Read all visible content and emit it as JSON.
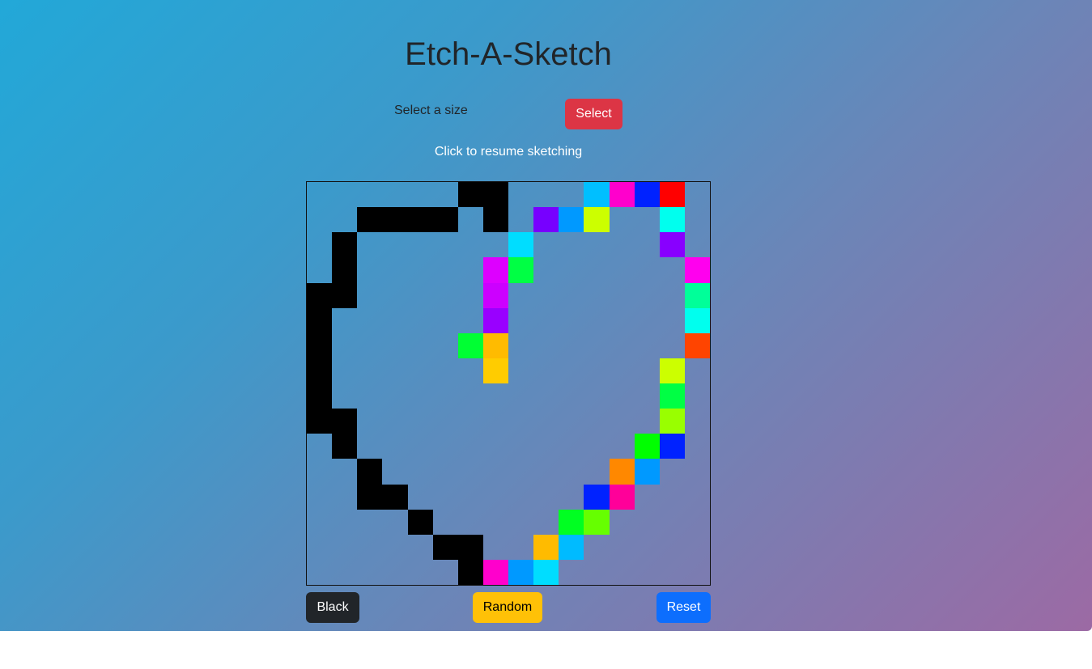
{
  "app": {
    "title": "Etch-A-Sketch",
    "size_label": "Select a size",
    "select_label": "Select",
    "status_text": "Click to resume sketching"
  },
  "controls": {
    "black_label": "Black",
    "random_label": "Random",
    "reset_label": "Reset"
  },
  "colors": {
    "gradient_start": "#22a8d8",
    "gradient_end": "#9c6aa4",
    "select_button": "#dc3545",
    "black_button": "#212529",
    "random_button": "#ffc107",
    "reset_button": "#0d6efd"
  },
  "grid": {
    "size": 16,
    "painted": [
      {
        "r": 0,
        "c": 6,
        "color": "#000000"
      },
      {
        "r": 0,
        "c": 7,
        "color": "#000000"
      },
      {
        "r": 0,
        "c": 11,
        "color": "#00bfff"
      },
      {
        "r": 0,
        "c": 12,
        "color": "#ff00cc"
      },
      {
        "r": 0,
        "c": 13,
        "color": "#0022ff"
      },
      {
        "r": 0,
        "c": 14,
        "color": "#ff0000"
      },
      {
        "r": 1,
        "c": 2,
        "color": "#000000"
      },
      {
        "r": 1,
        "c": 3,
        "color": "#000000"
      },
      {
        "r": 1,
        "c": 4,
        "color": "#000000"
      },
      {
        "r": 1,
        "c": 5,
        "color": "#000000"
      },
      {
        "r": 1,
        "c": 7,
        "color": "#000000"
      },
      {
        "r": 1,
        "c": 9,
        "color": "#7700ff"
      },
      {
        "r": 1,
        "c": 10,
        "color": "#0099ff"
      },
      {
        "r": 1,
        "c": 11,
        "color": "#ccff00"
      },
      {
        "r": 1,
        "c": 14,
        "color": "#00ffee"
      },
      {
        "r": 2,
        "c": 1,
        "color": "#000000"
      },
      {
        "r": 2,
        "c": 8,
        "color": "#00ddff"
      },
      {
        "r": 2,
        "c": 14,
        "color": "#8800ff"
      },
      {
        "r": 3,
        "c": 1,
        "color": "#000000"
      },
      {
        "r": 3,
        "c": 7,
        "color": "#dd00ff"
      },
      {
        "r": 3,
        "c": 8,
        "color": "#00ff44"
      },
      {
        "r": 3,
        "c": 15,
        "color": "#ff00ee"
      },
      {
        "r": 4,
        "c": 0,
        "color": "#000000"
      },
      {
        "r": 4,
        "c": 1,
        "color": "#000000"
      },
      {
        "r": 4,
        "c": 7,
        "color": "#cc00ff"
      },
      {
        "r": 4,
        "c": 15,
        "color": "#00ff99"
      },
      {
        "r": 5,
        "c": 0,
        "color": "#000000"
      },
      {
        "r": 5,
        "c": 7,
        "color": "#9900ff"
      },
      {
        "r": 5,
        "c": 15,
        "color": "#00ffee"
      },
      {
        "r": 6,
        "c": 0,
        "color": "#000000"
      },
      {
        "r": 6,
        "c": 6,
        "color": "#00ff33"
      },
      {
        "r": 6,
        "c": 7,
        "color": "#ffbb00"
      },
      {
        "r": 6,
        "c": 15,
        "color": "#ff4400"
      },
      {
        "r": 7,
        "c": 0,
        "color": "#000000"
      },
      {
        "r": 7,
        "c": 7,
        "color": "#ffcc00"
      },
      {
        "r": 7,
        "c": 14,
        "color": "#ccff00"
      },
      {
        "r": 8,
        "c": 0,
        "color": "#000000"
      },
      {
        "r": 8,
        "c": 14,
        "color": "#00ff44"
      },
      {
        "r": 9,
        "c": 0,
        "color": "#000000"
      },
      {
        "r": 9,
        "c": 1,
        "color": "#000000"
      },
      {
        "r": 9,
        "c": 14,
        "color": "#99ff00"
      },
      {
        "r": 10,
        "c": 1,
        "color": "#000000"
      },
      {
        "r": 10,
        "c": 13,
        "color": "#00ff00"
      },
      {
        "r": 10,
        "c": 14,
        "color": "#0022ff"
      },
      {
        "r": 11,
        "c": 2,
        "color": "#000000"
      },
      {
        "r": 11,
        "c": 12,
        "color": "#ff8800"
      },
      {
        "r": 11,
        "c": 13,
        "color": "#0099ff"
      },
      {
        "r": 12,
        "c": 2,
        "color": "#000000"
      },
      {
        "r": 12,
        "c": 3,
        "color": "#000000"
      },
      {
        "r": 12,
        "c": 11,
        "color": "#0022ff"
      },
      {
        "r": 12,
        "c": 12,
        "color": "#ff0099"
      },
      {
        "r": 13,
        "c": 4,
        "color": "#000000"
      },
      {
        "r": 13,
        "c": 10,
        "color": "#00ff22"
      },
      {
        "r": 13,
        "c": 11,
        "color": "#66ff00"
      },
      {
        "r": 14,
        "c": 5,
        "color": "#000000"
      },
      {
        "r": 14,
        "c": 6,
        "color": "#000000"
      },
      {
        "r": 14,
        "c": 9,
        "color": "#ffbb00"
      },
      {
        "r": 14,
        "c": 10,
        "color": "#00bbff"
      },
      {
        "r": 15,
        "c": 6,
        "color": "#000000"
      },
      {
        "r": 15,
        "c": 7,
        "color": "#ff00cc"
      },
      {
        "r": 15,
        "c": 8,
        "color": "#0099ff"
      },
      {
        "r": 15,
        "c": 9,
        "color": "#00ddff"
      }
    ]
  }
}
